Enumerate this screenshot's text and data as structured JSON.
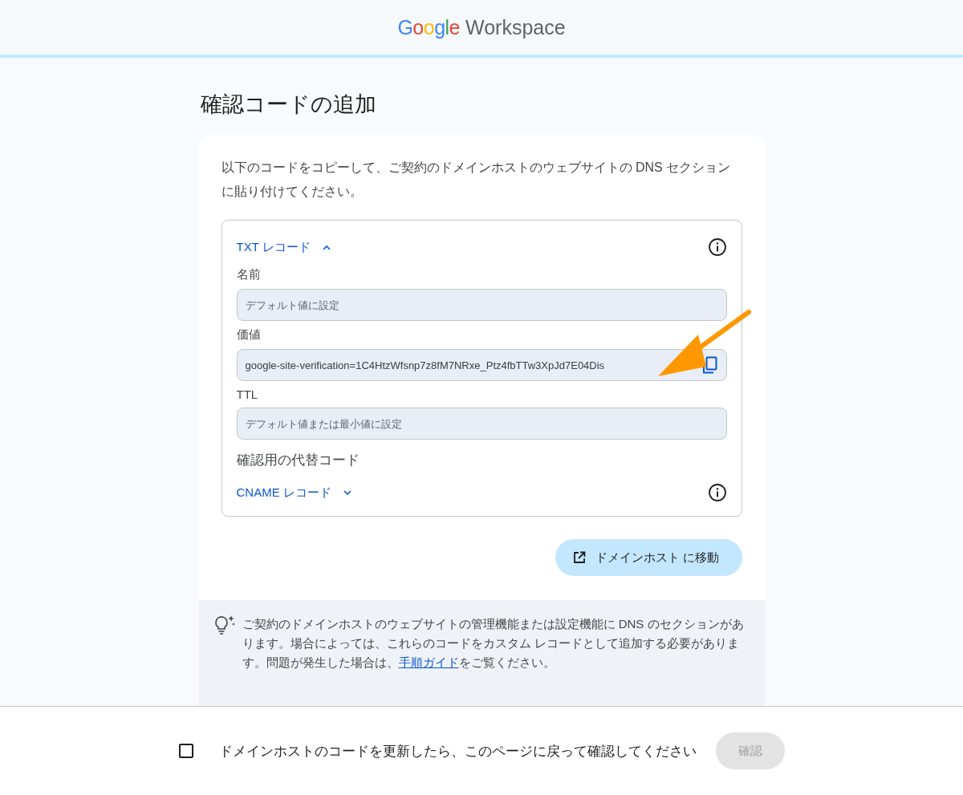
{
  "header": {
    "logo_google": "Google",
    "logo_product": "Workspace"
  },
  "title": "確認コードの追加",
  "intro": "以下のコードをコピーして、ご契約のドメインホストのウェブサイトの DNS セクションに貼り付けてください。",
  "records": [
    {
      "label": "TXT レコード",
      "expanded": true,
      "fields": [
        {
          "label": "名前",
          "placeholder": "デフォルト値に設定",
          "copyable": false
        },
        {
          "label": "価値",
          "value": "google-site-verification=1C4HtzWfsnp7z8fM7NRxe_Ptz4fbTTw3XpJd7E04Dis",
          "copyable": true
        },
        {
          "label": "TTL",
          "placeholder": "デフォルト値または最小値に設定",
          "copyable": false
        }
      ]
    },
    {
      "heading": "確認用の代替コード",
      "label": "CNAME レコード",
      "expanded": false
    }
  ],
  "domain_button": "ドメインホスト に移動",
  "tip": {
    "before": "ご契約のドメインホストのウェブサイトの管理機能または設定機能に DNS のセクションがあります。場合によっては、これらのコードをカスタム レコードとして追加する必要があります。問題が発生した場合は、",
    "link": "手順ガイド",
    "after": "をご覧ください。"
  },
  "footer": {
    "checkbox_label": "ドメインホストのコードを更新したら、このページに戻って確認してください",
    "checked": false,
    "confirm": "確認",
    "confirm_disabled": true
  }
}
